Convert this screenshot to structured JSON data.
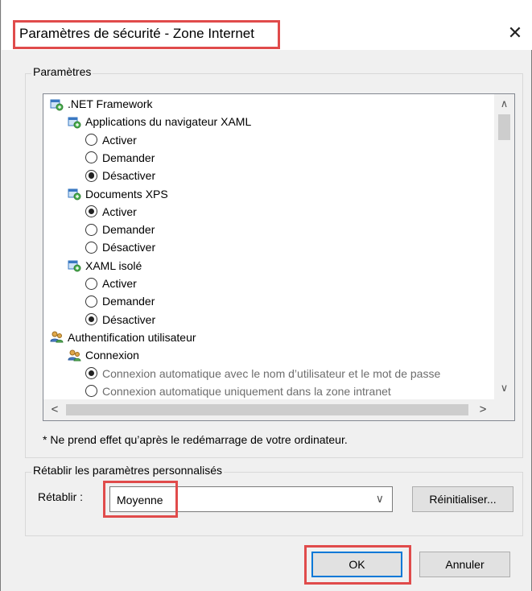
{
  "dialog": {
    "title": "Paramètres de sécurité - Zone Internet",
    "close_glyph": "✕"
  },
  "settings_group": {
    "legend": "Paramètres",
    "tree": [
      {
        "kind": "category",
        "icon": "net-framework-icon",
        "label": ".NET Framework"
      },
      {
        "kind": "subcategory",
        "icon": "net-framework-icon",
        "label": "Applications du navigateur XAML"
      },
      {
        "kind": "option",
        "label": "Activer",
        "selected": false
      },
      {
        "kind": "option",
        "label": "Demander",
        "selected": false
      },
      {
        "kind": "option",
        "label": "Désactiver",
        "selected": true
      },
      {
        "kind": "subcategory",
        "icon": "net-framework-icon",
        "label": "Documents XPS"
      },
      {
        "kind": "option",
        "label": "Activer",
        "selected": true
      },
      {
        "kind": "option",
        "label": "Demander",
        "selected": false
      },
      {
        "kind": "option",
        "label": "Désactiver",
        "selected": false
      },
      {
        "kind": "subcategory",
        "icon": "net-framework-icon",
        "label": "XAML isolé"
      },
      {
        "kind": "option",
        "label": "Activer",
        "selected": false
      },
      {
        "kind": "option",
        "label": "Demander",
        "selected": false
      },
      {
        "kind": "option",
        "label": "Désactiver",
        "selected": true
      },
      {
        "kind": "category",
        "icon": "users-icon",
        "label": "Authentification utilisateur"
      },
      {
        "kind": "subcategory",
        "icon": "users-icon",
        "label": "Connexion"
      },
      {
        "kind": "option-dim",
        "label": "Connexion automatique avec le nom d’utilisateur et le mot de passe",
        "selected": true
      },
      {
        "kind": "option-dim",
        "label": "Connexion automatique uniquement dans la zone intranet",
        "selected": false
      }
    ],
    "scroll_up_glyph": "∧",
    "scroll_down_glyph": "∨",
    "scroll_left_glyph": "<",
    "scroll_right_glyph": ">"
  },
  "note": "* Ne prend effet qu’après le redémarrage de votre ordinateur.",
  "reset_group": {
    "legend": "Rétablir les paramètres personnalisés",
    "reset_label": "Rétablir :",
    "level_value": "Moyenne",
    "chevron_glyph": "∨",
    "reset_button": "Réinitialiser..."
  },
  "footer": {
    "ok": "OK",
    "cancel": "Annuler"
  },
  "colors": {
    "highlight": "#e04b4b",
    "default_button_border": "#0078d7"
  }
}
